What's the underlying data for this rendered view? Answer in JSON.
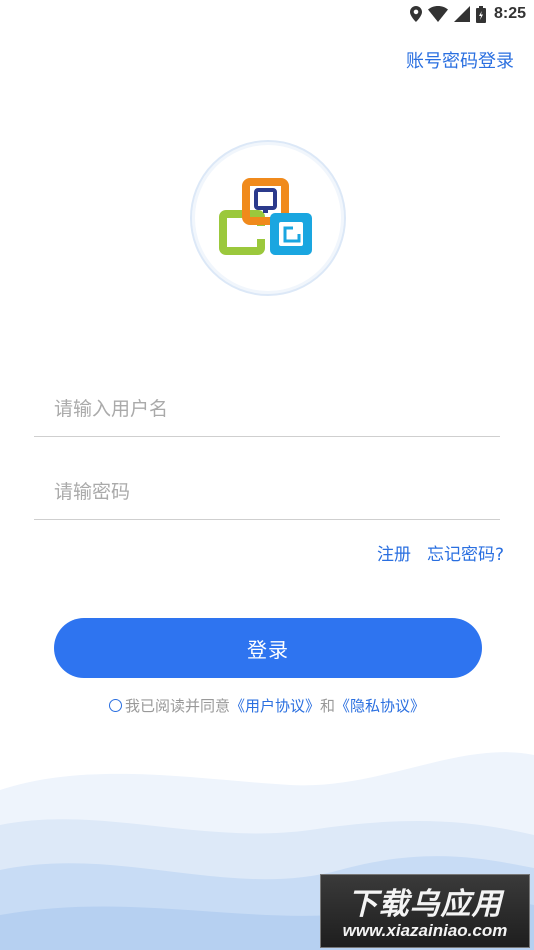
{
  "status_bar": {
    "time": "8:25",
    "icons": [
      "location-icon",
      "wifi-icon",
      "signal-icon",
      "battery-icon"
    ]
  },
  "header": {
    "account_login_link": "账号密码登录"
  },
  "logo": {
    "name": "app-logo",
    "colors": {
      "orange": "#f08a1c",
      "navy": "#2b3a8c",
      "green": "#9bc83c",
      "cyan": "#1aa6e0"
    }
  },
  "form": {
    "username": {
      "value": "",
      "placeholder": "请输入用户名"
    },
    "password": {
      "value": "",
      "placeholder": "请输密码"
    },
    "register_label": "注册",
    "forgot_label": "忘记密码?",
    "login_label": "登录"
  },
  "agreement": {
    "checked": false,
    "prefix": "我已阅读并同意",
    "user_agreement": "《用户协议》",
    "conjunction": "和",
    "privacy_policy": "《隐私协议》"
  },
  "colors": {
    "accent": "#2a6fe0",
    "button": "#2e74f0",
    "wave_light": "#e8f1fc",
    "wave_mid": "#d3e4f8",
    "wave_dark": "#b9d3f2"
  },
  "watermark": {
    "title": "下载乌应用",
    "url": "www.xiazainiao.com"
  }
}
